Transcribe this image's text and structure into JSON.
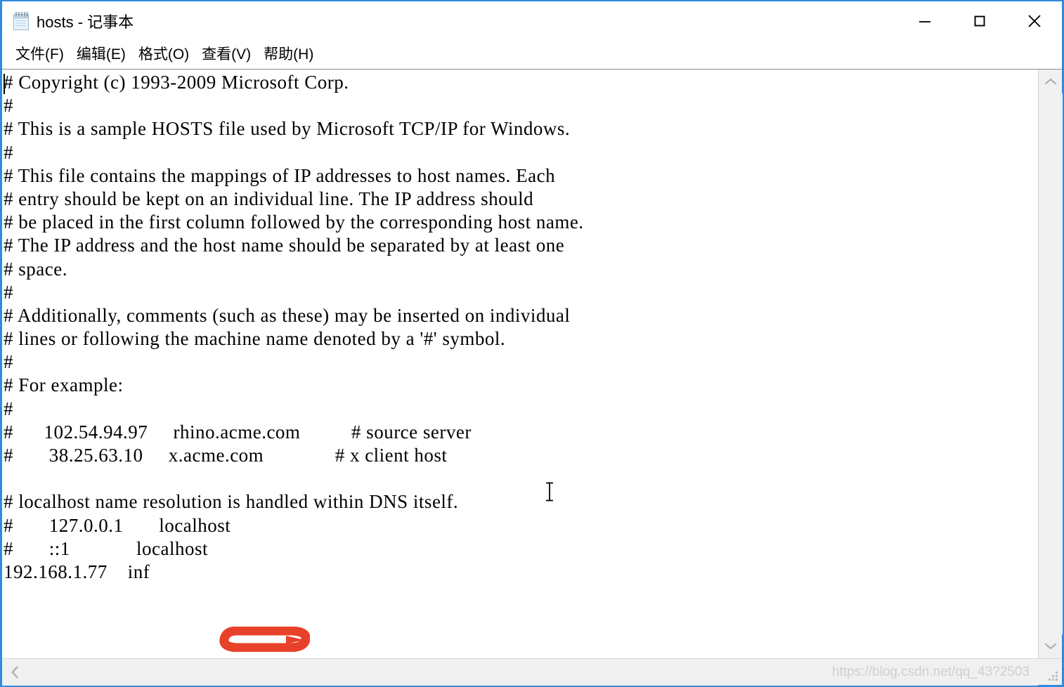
{
  "window": {
    "title": "hosts - 记事本",
    "icon": "notepad-icon",
    "border_color": "#2F8AE0",
    "controls": {
      "minimize": "—",
      "maximize": "□",
      "close": "✕"
    }
  },
  "menubar": {
    "items": [
      {
        "label": "文件(F)",
        "name": "menu-file"
      },
      {
        "label": "编辑(E)",
        "name": "menu-edit"
      },
      {
        "label": "格式(O)",
        "name": "menu-format"
      },
      {
        "label": "查看(V)",
        "name": "menu-view"
      },
      {
        "label": "帮助(H)",
        "name": "menu-help"
      }
    ]
  },
  "editor": {
    "filename": "hosts",
    "content": "# Copyright (c) 1993-2009 Microsoft Corp.\n#\n# This is a sample HOSTS file used by Microsoft TCP/IP for Windows.\n#\n# This file contains the mappings of IP addresses to host names. Each\n# entry should be kept on an individual line. The IP address should\n# be placed in the first column followed by the corresponding host name.\n# The IP address and the host name should be separated by at least one\n# space.\n#\n# Additionally, comments (such as these) may be inserted on individual\n# lines or following the machine name denoted by a '#' symbol.\n#\n# For example:\n#\n#      102.54.94.97     rhino.acme.com          # source server\n#       38.25.63.10     x.acme.com              # x client host\n\n# localhost name resolution is handled within DNS itself.\n#\t127.0.0.1       localhost\n#\t::1             localhost\n192.168.1.77    inf█████",
    "lines": [
      "# Copyright (c) 1993-2009 Microsoft Corp.",
      "#",
      "# This is a sample HOSTS file used by Microsoft TCP/IP for Windows.",
      "#",
      "# This file contains the mappings of IP addresses to host names. Each",
      "# entry should be kept on an individual line. The IP address should",
      "# be placed in the first column followed by the corresponding host name.",
      "# The IP address and the host name should be separated by at least one",
      "# space.",
      "#",
      "# Additionally, comments (such as these) may be inserted on individual",
      "# lines or following the machine name denoted by a '#' symbol.",
      "#",
      "# For example:",
      "#",
      "#      102.54.94.97     rhino.acme.com          # source server",
      "#       38.25.63.10     x.acme.com              # x client host",
      "",
      "# localhost name resolution is handled within DNS itself.",
      "#       127.0.0.1       localhost",
      "#       ::1             localhost",
      "192.168.1.77    inf"
    ],
    "caret_visible": true,
    "mouse_cursor": "i-beam"
  },
  "annotation": {
    "type": "red-ellipse-scribble",
    "color": "#E8412A",
    "covers_text": "192.168.1.77 inf____"
  },
  "scrollbars": {
    "vertical": {
      "up_arrow": "˄",
      "down_arrow": "˅"
    },
    "horizontal": {
      "left_arrow": "‹",
      "right_arrow": "›"
    }
  },
  "watermark": {
    "text": "https://blog.csdn.net/qq_43?2503"
  }
}
